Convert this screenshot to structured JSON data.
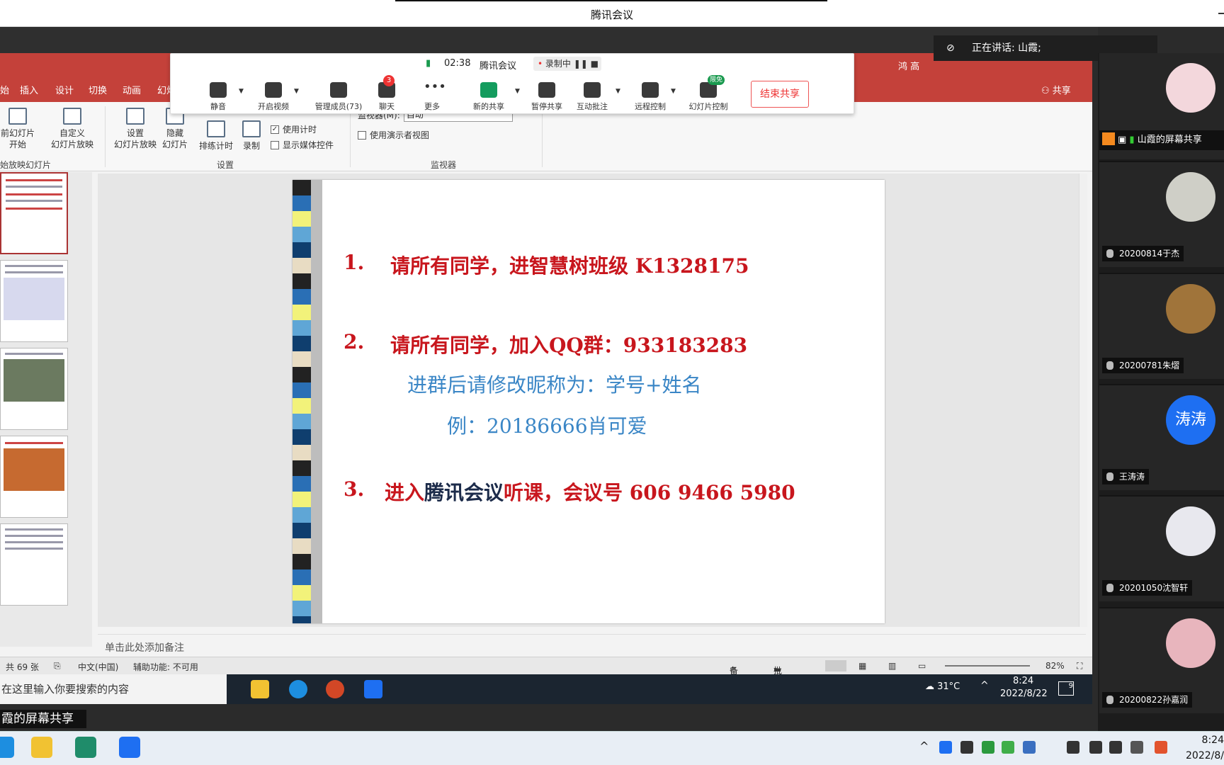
{
  "window": {
    "title": "腾讯会议"
  },
  "ppt": {
    "tabs": [
      "始",
      "插入",
      "设计",
      "切换",
      "动画",
      "幻灯"
    ],
    "right_tabs": {
      "user": "鸿 高",
      "share": "共享"
    },
    "ribbon": {
      "from_current": [
        "前幻灯片",
        "开始"
      ],
      "custom_show": [
        "自定义",
        "幻灯片放映"
      ],
      "setup_show": [
        "设置",
        "幻灯片放映"
      ],
      "hide_slide": [
        "隐藏",
        "幻灯片"
      ],
      "rehearse": "排练计时",
      "record": "录制",
      "use_timing": "使用计时",
      "show_media": "显示媒体控件",
      "monitor_label": "监视器(M):",
      "monitor_value": "自动",
      "presenter_view": "使用演示者视图",
      "group_start": "始放映幻灯片",
      "group_setup": "设置",
      "group_monitor": "监视器"
    },
    "slide": {
      "line1_num": "1.",
      "line1": "请所有同学，进智慧树班级 K1328175",
      "line2_num": "2.",
      "line2": "请所有同学，加入QQ群：933183283",
      "line2b": "进群后请修改昵称为：学号+姓名",
      "line2c": "例：20186666肖可爱",
      "line3_num": "3.",
      "line3_a": "进入",
      "line3_b": "腾讯会议",
      "line3_c": "听课，会议号 606 9466 5980"
    },
    "notes_placeholder": "单击此处添加备注",
    "status": {
      "slide_count": "共 69 张",
      "language": "中文(中国)",
      "accessibility": "辅助功能: 不可用",
      "notes_btn": "备注",
      "comments_btn": "批注",
      "zoom": "82%"
    }
  },
  "meeting_bar": {
    "time": "02:38",
    "title": "腾讯会议",
    "recording": "录制中",
    "buttons": {
      "mute": "静音",
      "video": "开启视频",
      "members": "管理成员(73)",
      "chat": "聊天",
      "chat_badge": "3",
      "more": "更多",
      "new_share": "新的共享",
      "pause_share": "暂停共享",
      "annotate": "互动批注",
      "remote": "远程控制",
      "slide_ctrl": "幻灯片控制",
      "slide_badge": "限免"
    },
    "end_share": "结束共享"
  },
  "speaking": "正在讲话: 山霞;",
  "participants": {
    "host_label": "山霞的屏幕共享",
    "list": [
      {
        "name": "20200814于杰"
      },
      {
        "name": "20200781朱熠"
      },
      {
        "name": "王涛涛",
        "initials": "涛涛"
      },
      {
        "name": "20201050沈智轩"
      },
      {
        "name": "20200822孙嘉润"
      }
    ]
  },
  "inner_taskbar": {
    "search_placeholder": "在这里输入你要搜索的内容",
    "weather": "31°C",
    "time": "8:24",
    "date": "2022/8/22",
    "notif": "9"
  },
  "caption": "霞的屏幕共享",
  "outer_taskbar": {
    "time": "8:24",
    "date": "2022/8/"
  }
}
